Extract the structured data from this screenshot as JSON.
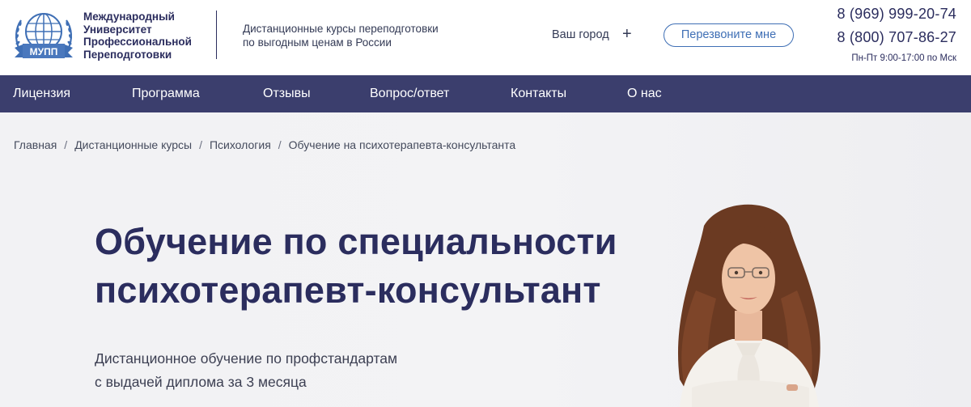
{
  "header": {
    "logo_badge": "МУПП",
    "logo_lines": [
      "Международный",
      "Университет",
      "Профессиональной",
      "Переподготовки"
    ],
    "tagline_lines": [
      "Дистанционные курсы переподготовки",
      "по выгодным ценам в России"
    ],
    "city_label": "Ваш город",
    "city_plus": "+",
    "callback_label": "Перезвоните мне",
    "phone1": "8 (969) 999-20-74",
    "phone2": "8 (800) 707-86-27",
    "hours": "Пн-Пт 9:00-17:00 по Мск"
  },
  "nav": {
    "items": [
      "Лицензия",
      "Программа",
      "Отзывы",
      "Вопрос/ответ",
      "Контакты",
      "О нас"
    ]
  },
  "breadcrumb": {
    "items": [
      "Главная",
      "Дистанционные курсы",
      "Психология",
      "Обучение на психотерапевта-консультанта"
    ],
    "separator": "/"
  },
  "hero": {
    "title_lines": [
      "Обучение по специальности",
      "психотерапевт-консультант"
    ],
    "subtitle_lines": [
      "Дистанционное обучение по профстандартам",
      "с выдачей диплома за 3 месяца"
    ]
  },
  "colors": {
    "brand_navy": "#2b2d5e",
    "nav_bg": "#3b3e6d",
    "accent_blue": "#3f6fb5",
    "hero_bg": "#f2f2f4"
  }
}
